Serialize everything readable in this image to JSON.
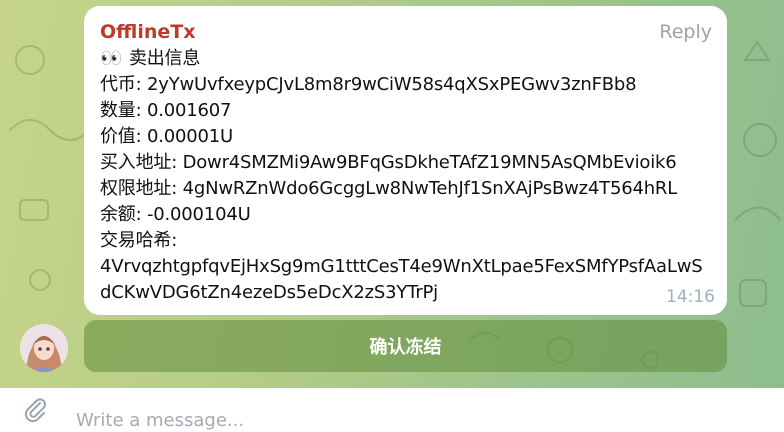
{
  "message": {
    "sender": "OfflineTx",
    "reply_label": "Reply",
    "time": "14:16",
    "title_emoji": "👀",
    "title": "卖出信息",
    "lines": [
      "代币: 2yYwUvfxeypCJvL8m8r9wCiW58s4qXSxPEGwv3znFBb8",
      "数量: 0.001607",
      "价值: 0.00001U",
      "买入地址: Dowr4SMZMi9Aw9BFqGsDkheTAfZ19MN5AsQMbEvioik6",
      "权限地址: 4gNwRZnWdo6GcggLw8NwTehJf1SnXAjPsBwz4T564hRL",
      "余额: -0.000104U",
      "交易哈希:"
    ],
    "tx_hash": "4VrvqzhtgpfqvEjHxSg9mG1tttCesT4e9WnXtLpae5FexSMfYPsfAaLwSdCKwVDG6tZn4ezeDs5eDcX2zS3YTrPj"
  },
  "action_button": {
    "label": "确认冻结"
  },
  "composer": {
    "placeholder": "Write a message..."
  },
  "colors": {
    "sender": "#c0392b",
    "bubble": "#ffffff",
    "button": "#7fa05a"
  },
  "icons": [
    "paperclip-icon",
    "avatar"
  ]
}
